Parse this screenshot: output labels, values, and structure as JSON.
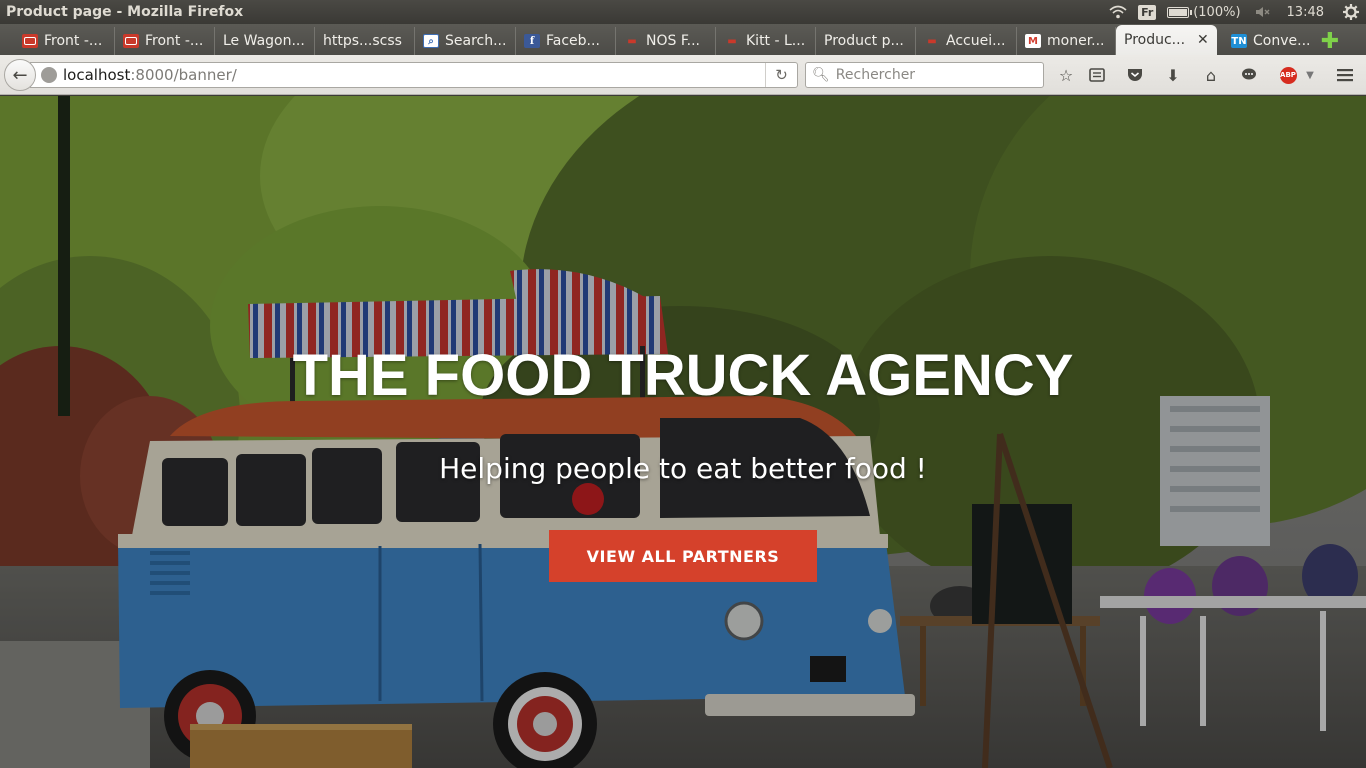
{
  "os": {
    "window_title": "Product page - Mozilla Firefox",
    "language": "Fr",
    "battery": "(100%)",
    "battery_level": 1.0,
    "clock": "13:48"
  },
  "tabs": [
    {
      "label": "Front -...",
      "favicon": "red-card-icon"
    },
    {
      "label": "Front -...",
      "favicon": "red-card-icon"
    },
    {
      "label": "Le Wagon...",
      "favicon": ""
    },
    {
      "label": "https...scss",
      "favicon": ""
    },
    {
      "label": "Search...",
      "favicon": "search-favicon-icon"
    },
    {
      "label": "Faceb...",
      "favicon": "facebook-icon"
    },
    {
      "label": "NOS F...",
      "favicon": "red-truck-icon"
    },
    {
      "label": "Kitt - L...",
      "favicon": "red-truck-icon"
    },
    {
      "label": "Product p...",
      "favicon": ""
    },
    {
      "label": "Accuei...",
      "favicon": "red-truck-icon"
    },
    {
      "label": "moner...",
      "favicon": "gmail-icon"
    },
    {
      "label": "Produc...",
      "favicon": "",
      "active": true
    },
    {
      "label": "Conve...",
      "favicon": "tn-icon"
    }
  ],
  "nav": {
    "url_host": "localhost",
    "url_rest": ":8000/banner/",
    "search_placeholder": "Rechercher"
  },
  "banner": {
    "title": "THE FOOD TRUCK AGENCY",
    "subtitle": "Helping people to eat better food !",
    "button_label": "VIEW ALL PARTNERS"
  },
  "colors": {
    "accent_button": "#d5412b",
    "truck_blue": "#3f86c6",
    "awning_red": "#c8352f"
  }
}
